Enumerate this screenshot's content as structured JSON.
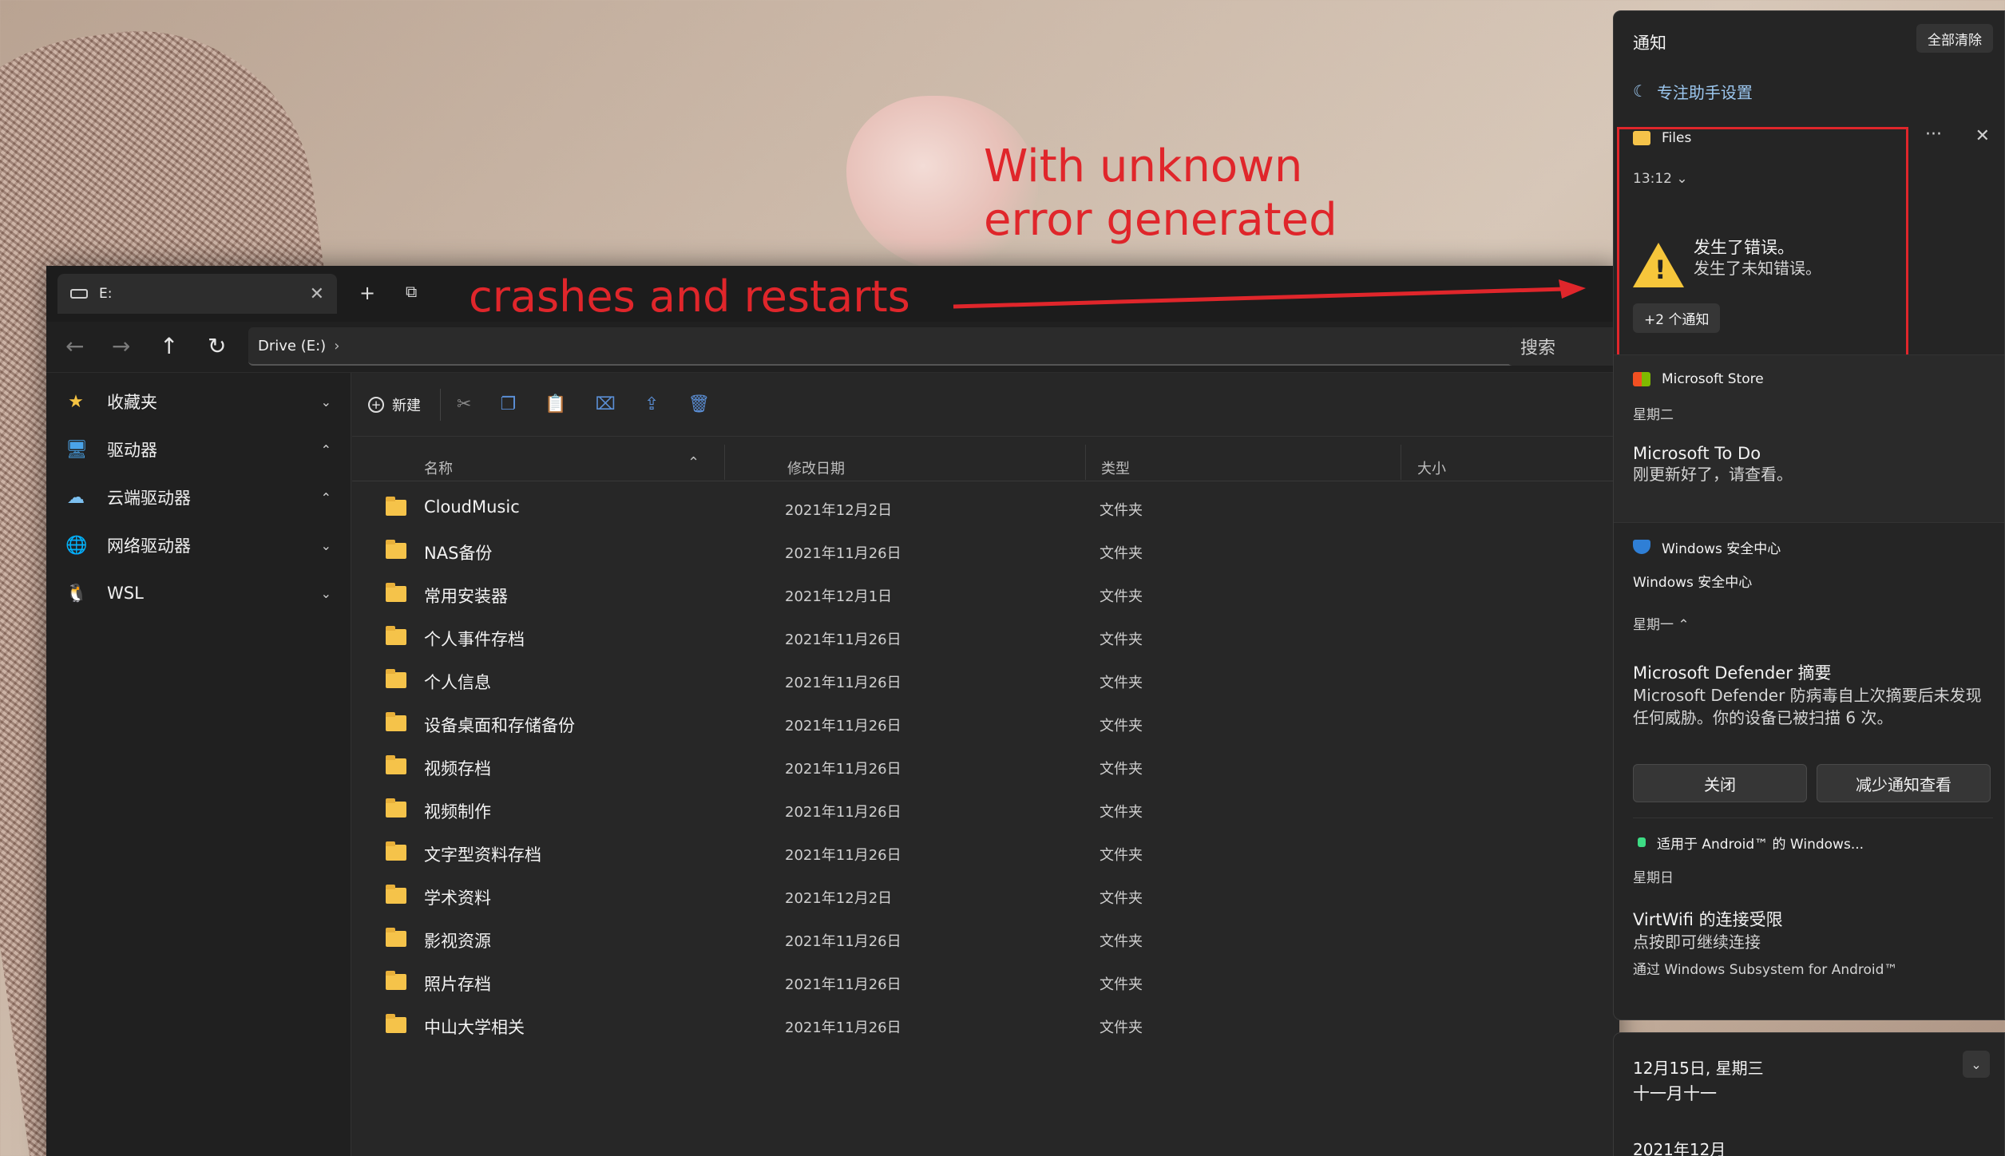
{
  "annotations": {
    "top_text": "With unknown error generated",
    "crash_text": "crashes and restarts",
    "color": "#e0262b"
  },
  "explorer": {
    "tab": {
      "label": "E:",
      "close": "✕"
    },
    "new_tab": "+",
    "address": {
      "segment": "Drive (E:)"
    },
    "search_placeholder": "搜索",
    "toolbar": {
      "new_label": "新建"
    },
    "sidebar": [
      {
        "label": "收藏夹",
        "icon": "star-icon",
        "glyph": "★",
        "color": "#f5c342",
        "chevron": "⌄"
      },
      {
        "label": "驱动器",
        "icon": "monitor-icon",
        "glyph": "🖥",
        "color": "#4aa3e8",
        "chevron": "⌃"
      },
      {
        "label": "云端驱动器",
        "icon": "cloud-drive-icon",
        "glyph": "☁",
        "color": "#7cc0f0",
        "chevron": "⌃"
      },
      {
        "label": "网络驱动器",
        "icon": "network-icon",
        "glyph": "🌐",
        "color": "#4aa3e8",
        "chevron": "⌄"
      },
      {
        "label": "WSL",
        "icon": "linux-penguin-icon",
        "glyph": "🐧",
        "color": "#f0f0f0",
        "chevron": "⌄"
      }
    ],
    "columns": {
      "name": "名称",
      "modified": "修改日期",
      "type": "类型",
      "size": "大小"
    },
    "files": [
      {
        "name": "CloudMusic",
        "date": "2021年12月2日",
        "type": "文件夹"
      },
      {
        "name": "NAS备份",
        "date": "2021年11月26日",
        "type": "文件夹"
      },
      {
        "name": "常用安装器",
        "date": "2021年12月1日",
        "type": "文件夹"
      },
      {
        "name": "个人事件存档",
        "date": "2021年11月26日",
        "type": "文件夹"
      },
      {
        "name": "个人信息",
        "date": "2021年11月26日",
        "type": "文件夹"
      },
      {
        "name": "设备桌面和存储备份",
        "date": "2021年11月26日",
        "type": "文件夹"
      },
      {
        "name": "视频存档",
        "date": "2021年11月26日",
        "type": "文件夹"
      },
      {
        "name": "视频制作",
        "date": "2021年11月26日",
        "type": "文件夹"
      },
      {
        "name": "文字型资料存档",
        "date": "2021年11月26日",
        "type": "文件夹"
      },
      {
        "name": "学术资料",
        "date": "2021年12月2日",
        "type": "文件夹"
      },
      {
        "name": "影视资源",
        "date": "2021年11月26日",
        "type": "文件夹"
      },
      {
        "name": "照片存档",
        "date": "2021年11月26日",
        "type": "文件夹"
      },
      {
        "name": "中山大学相关",
        "date": "2021年11月26日",
        "type": "文件夹"
      }
    ]
  },
  "notifications": {
    "title": "通知",
    "clear_all": "全部清除",
    "focus_assist": "专注助手设置",
    "files": {
      "app": "Files",
      "time": "13:12",
      "title": "发生了错误。",
      "body": "发生了未知错误。",
      "more": "+2 个通知"
    },
    "store": {
      "app": "Microsoft Store",
      "day": "星期二",
      "title": "Microsoft To Do",
      "body": "刚更新好了，请查看。"
    },
    "security": {
      "app": "Windows 安全中心",
      "sub": "Windows 安全中心",
      "day": "星期一",
      "title": "Microsoft Defender 摘要",
      "body": "Microsoft Defender 防病毒自上次摘要后未发现任何威胁。你的设备已被扫描 6 次。",
      "btn_close": "关闭",
      "btn_reduce": "减少通知查看"
    },
    "wsa": {
      "app": "适用于 Android™ 的 Windows...",
      "day": "星期日",
      "title": "VirtWifi 的连接受限",
      "body": "点按即可继续连接",
      "via": "通过 Windows Subsystem for Android™"
    }
  },
  "calendar": {
    "date": "12月15日, 星期三",
    "lunar": "十一月十一",
    "month": "2021年12月"
  }
}
